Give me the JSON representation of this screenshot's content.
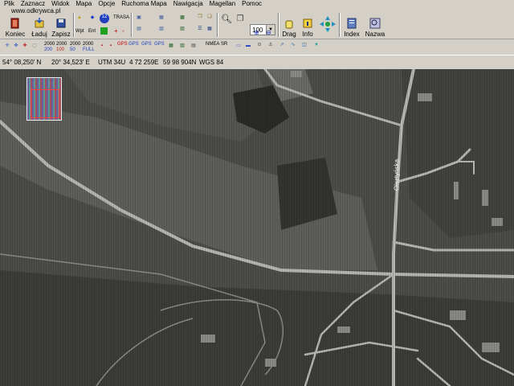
{
  "menu": {
    "items": [
      "Plik",
      "Zaznacz",
      "Widok",
      "Mapa",
      "Opcje",
      "Ruchoma Mapa",
      "Nawigacja",
      "Magellan",
      "Pomoc"
    ]
  },
  "watermark": "www.odkrywca.pl",
  "toolbar": {
    "koniec": "Koniec",
    "laduj": "Ładuj",
    "zapisz": "Zapisz",
    "wpt": "Wpt",
    "ent": "Ent",
    "badge12": "12",
    "trasa": "TRASA",
    "zoom_value": "100",
    "drag": "Drag",
    "info": "Info",
    "index": "Index",
    "nazwa": "Nazwa",
    "zoom_buttons": [
      {
        "top": "2000",
        "bottom": "200"
      },
      {
        "top": "2000",
        "bottom": "100"
      },
      {
        "top": "2000",
        "bottom": "50"
      },
      {
        "top": "2000",
        "bottom": "FULL"
      }
    ],
    "gps_labels": [
      "GPS",
      "GPS",
      "GPS",
      "GPS"
    ],
    "nmea": "NMEA",
    "sr": "SR"
  },
  "status": {
    "lat": "54° 08,250' N",
    "lon": "20° 34,523' E",
    "utm_zone": "UTM  34U",
    "easting": "4 72 259E",
    "northing": "59 98 904N",
    "datum": "WGS 84"
  },
  "map": {
    "street_label": "Olsztyńska"
  }
}
